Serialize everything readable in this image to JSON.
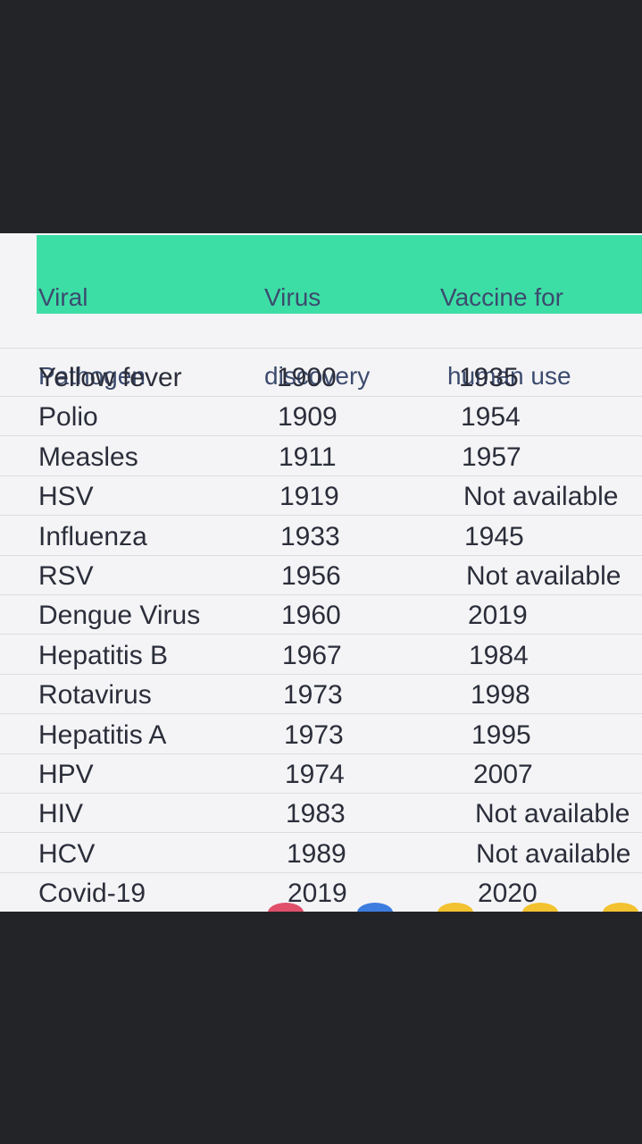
{
  "table": {
    "headers": [
      {
        "line1": "Viral",
        "line2": "Pathogen"
      },
      {
        "line1": "Virus",
        "line2": "discovery"
      },
      {
        "line1": "Vaccine for",
        "line2": "human use"
      }
    ],
    "rows": [
      {
        "pathogen": "Yellow fever",
        "discovery": "1900",
        "vaccine": "1935"
      },
      {
        "pathogen": "Polio",
        "discovery": "1909",
        "vaccine": "1954"
      },
      {
        "pathogen": "Measles",
        "discovery": "1911",
        "vaccine": "1957"
      },
      {
        "pathogen": "HSV",
        "discovery": "1919",
        "vaccine": "Not available"
      },
      {
        "pathogen": "Influenza",
        "discovery": "1933",
        "vaccine": "1945"
      },
      {
        "pathogen": "RSV",
        "discovery": "1956",
        "vaccine": "Not available"
      },
      {
        "pathogen": "Dengue Virus",
        "discovery": "1960",
        "vaccine": "2019"
      },
      {
        "pathogen": "Hepatitis B",
        "discovery": "1967",
        "vaccine": "1984"
      },
      {
        "pathogen": "Rotavirus",
        "discovery": "1973",
        "vaccine": "1998"
      },
      {
        "pathogen": "Hepatitis A",
        "discovery": "1973",
        "vaccine": "1995"
      },
      {
        "pathogen": "HPV",
        "discovery": "1974",
        "vaccine": "2007"
      },
      {
        "pathogen": "HIV",
        "discovery": "1983",
        "vaccine": "Not available"
      },
      {
        "pathogen": "HCV",
        "discovery": "1989",
        "vaccine": "Not available"
      },
      {
        "pathogen": "Covid-19",
        "discovery": "2019",
        "vaccine": "2020"
      }
    ]
  },
  "colors": {
    "background": "#232427",
    "header_band": "#3ddea6",
    "header_text": "#3c4b6e",
    "body_text": "#2b2e3a",
    "paper": "#f4f4f6"
  }
}
